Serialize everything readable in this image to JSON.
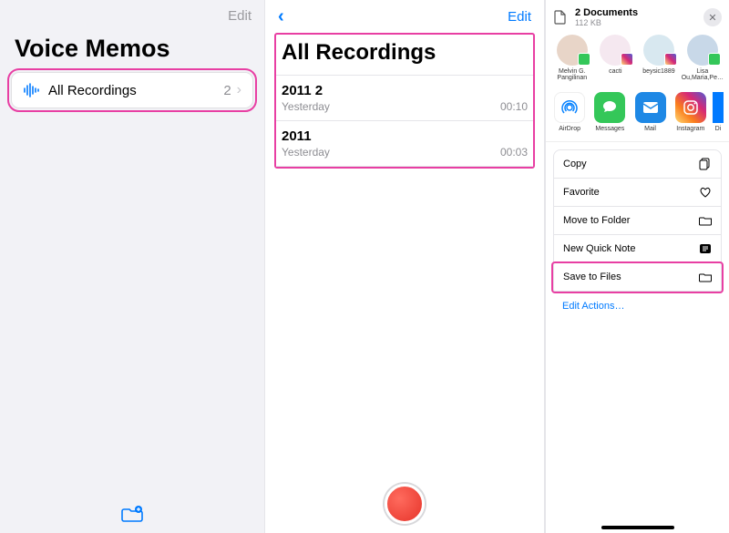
{
  "pane1": {
    "edit": "Edit",
    "title": "Voice Memos",
    "row": {
      "label": "All Recordings",
      "count": "2"
    }
  },
  "pane2": {
    "edit": "Edit",
    "title": "All Recordings",
    "recordings": [
      {
        "title": "2011 2",
        "sub": "Yesterday",
        "dur": "00:10"
      },
      {
        "title": "2011",
        "sub": "Yesterday",
        "dur": "00:03"
      }
    ]
  },
  "pane3": {
    "doc_title": "2 Documents",
    "doc_sub": "112 KB",
    "contacts": [
      {
        "name": "Melvin G. Pangilinan"
      },
      {
        "name": "cacti"
      },
      {
        "name": "beysic1889"
      },
      {
        "name": "Lisa Ou,Maria,Pe…"
      }
    ],
    "apps": [
      {
        "name": "AirDrop"
      },
      {
        "name": "Messages"
      },
      {
        "name": "Mail"
      },
      {
        "name": "Instagram"
      },
      {
        "name": "Di"
      }
    ],
    "actions": {
      "copy": "Copy",
      "favorite": "Favorite",
      "move": "Move to Folder",
      "note": "New Quick Note",
      "save": "Save to Files"
    },
    "edit_actions": "Edit Actions…"
  }
}
